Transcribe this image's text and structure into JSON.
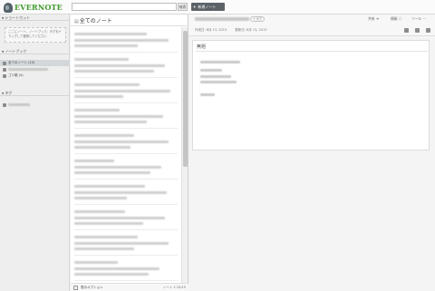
{
  "app": {
    "brand": "EVERNOTE",
    "new_note_label": "新規ノート",
    "search_button": "検索"
  },
  "sidebar": {
    "shortcuts_header": "ショートカット",
    "shortcuts_hint": "ここにノート、ノートブック、タグをドラッグして登録してください",
    "notebooks_header": "ノートブック",
    "notebooks": [
      {
        "label": "全てのノート (15)",
        "active": true
      },
      {
        "label": "",
        "active": false
      },
      {
        "label": "ゴミ箱 (4)",
        "active": false
      }
    ],
    "tags_header": "タグ"
  },
  "note_list": {
    "title": "全てのノート",
    "view_options": "表示オプション",
    "count": "ノート 1-15/15"
  },
  "editor": {
    "tag_pill": "+ タグ",
    "share": "共有",
    "info": "情報",
    "tools": "ツール",
    "created": "作成日: 8月 13, 2013",
    "updated": "更新日: 8月 13, 2013",
    "note_title": "無題"
  },
  "colors": {
    "brand_green": "#3f9a2b",
    "new_note_bg": "#5b6268",
    "active_notebook_bg": "#d3d7da"
  }
}
